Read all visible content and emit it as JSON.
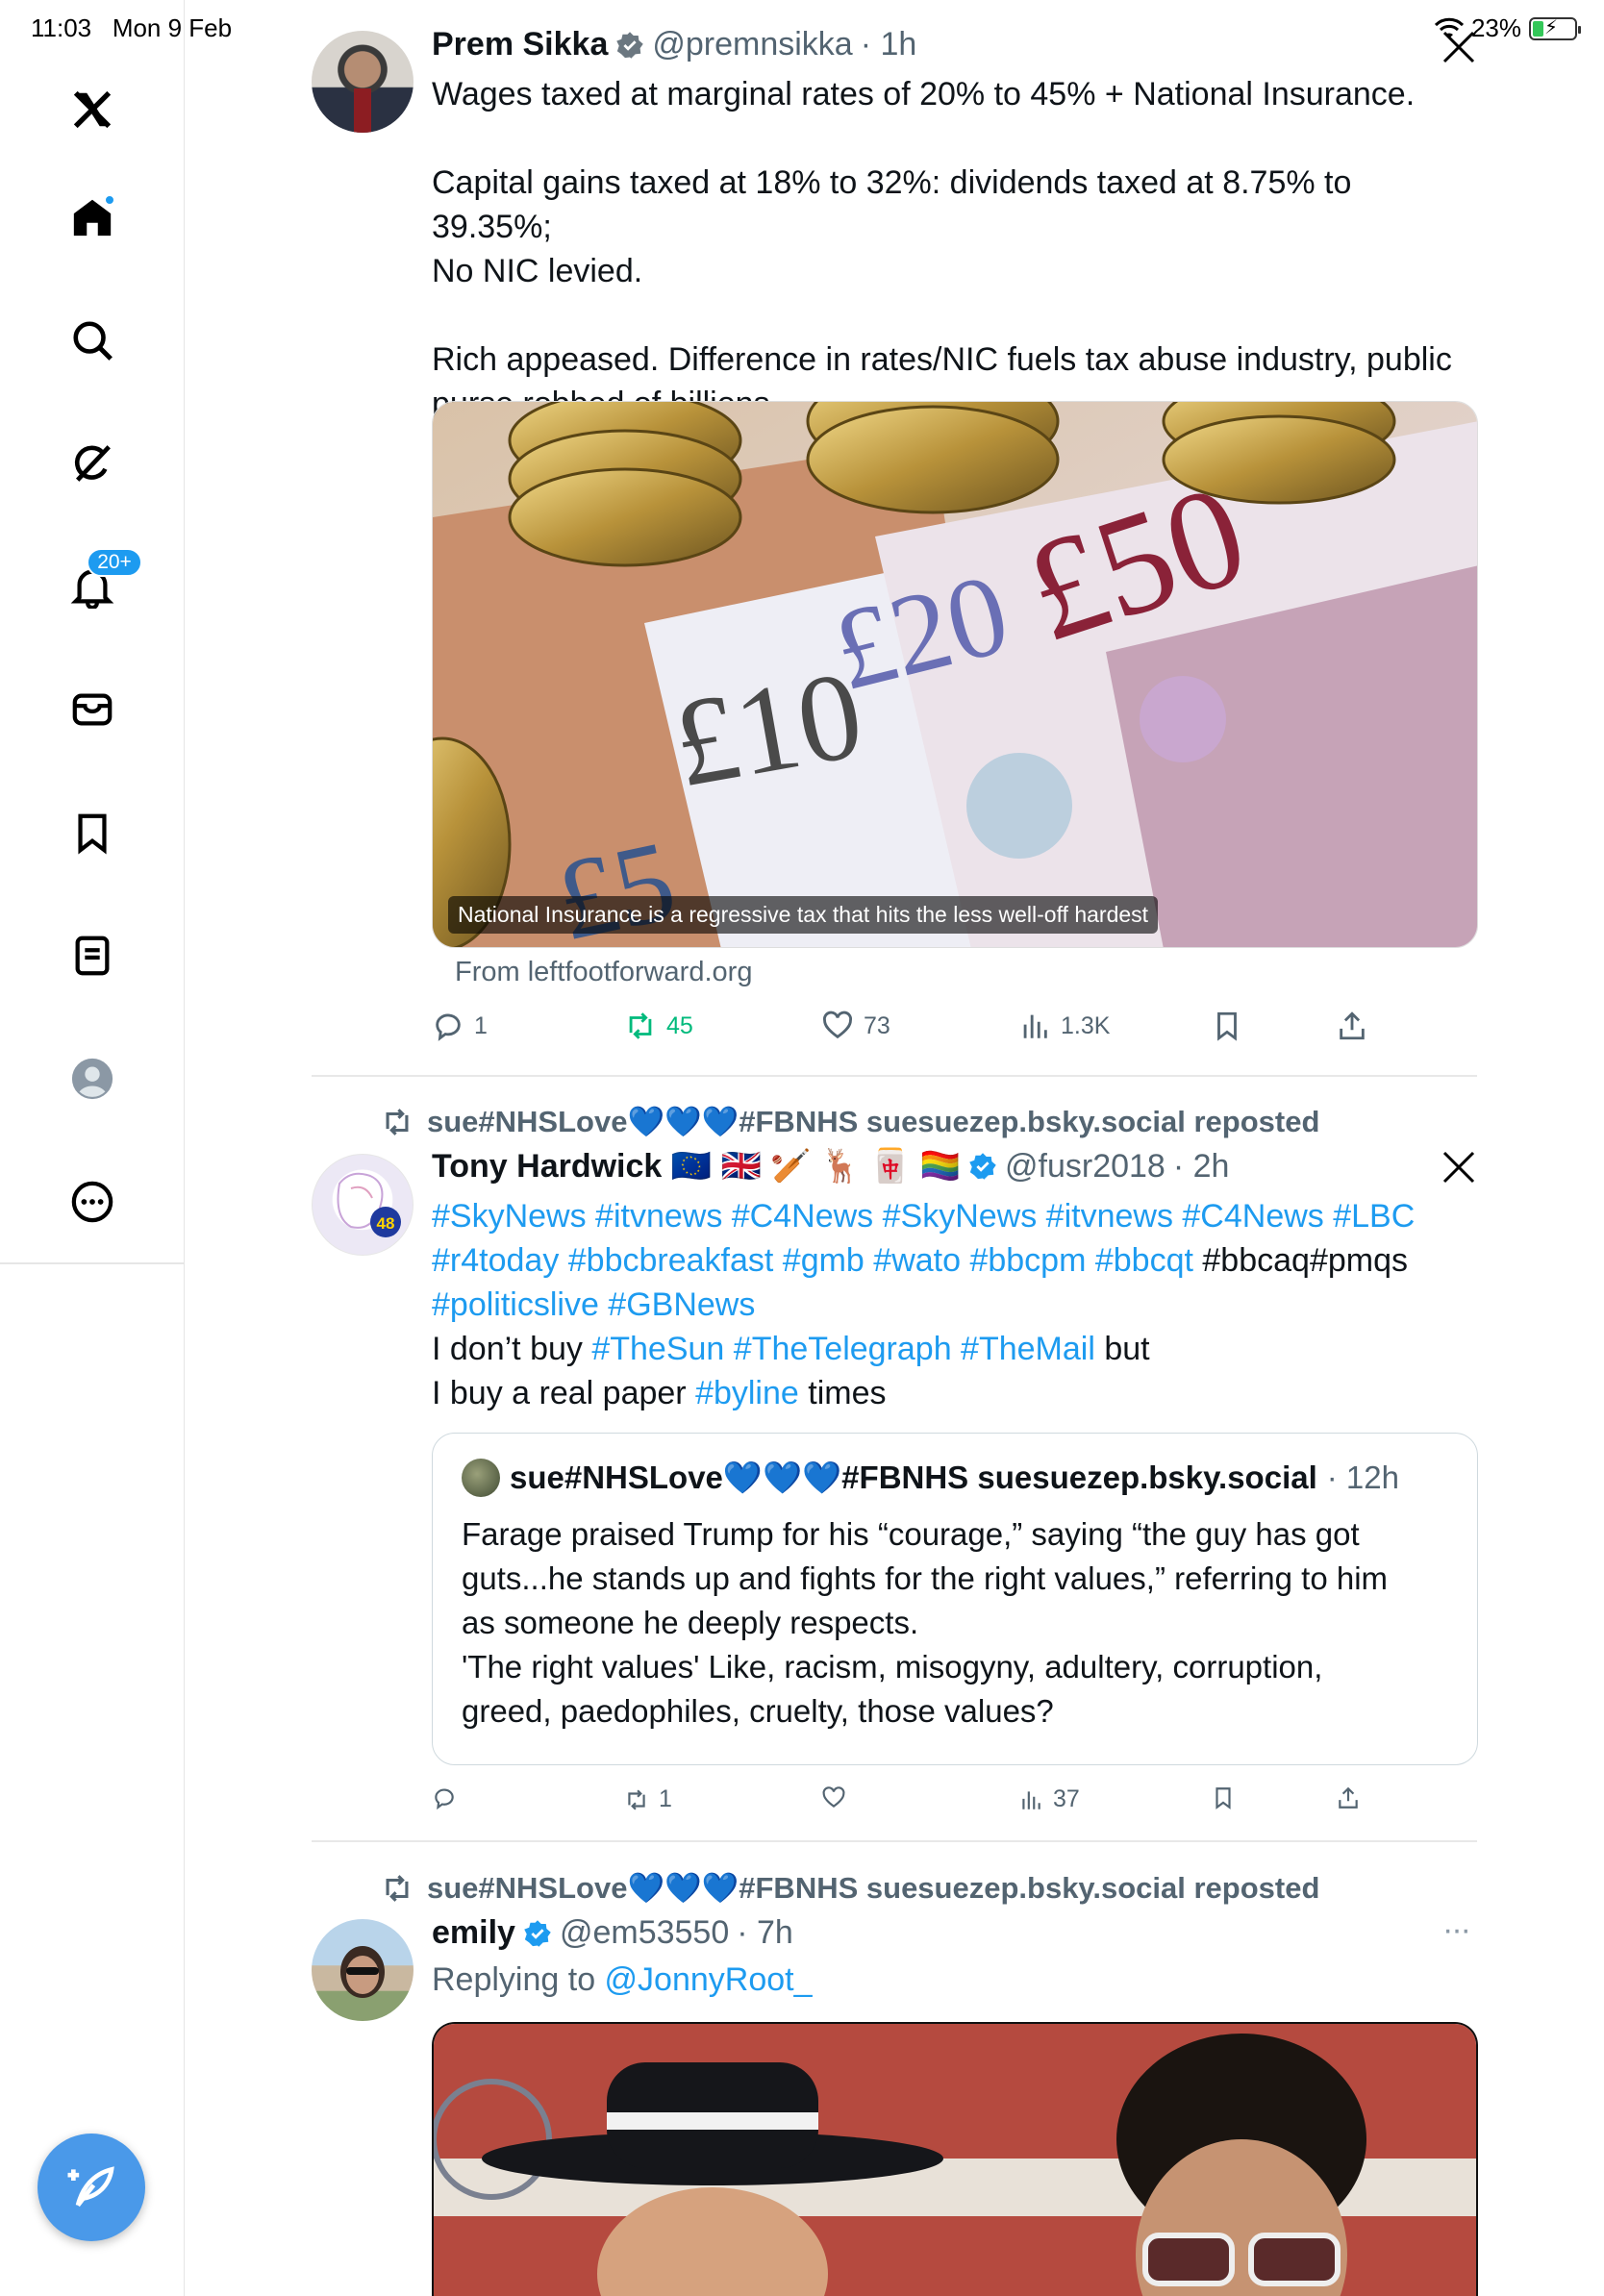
{
  "status_bar": {
    "time": "11:03",
    "date": "Mon 9 Feb",
    "battery": "23%"
  },
  "sidebar": {
    "items": [
      {
        "name": "x-logo",
        "label": "X"
      },
      {
        "name": "home",
        "label": "Home"
      },
      {
        "name": "search",
        "label": "Search"
      },
      {
        "name": "grok",
        "label": "Grok"
      },
      {
        "name": "notifications",
        "label": "Notifications",
        "badge": "20+"
      },
      {
        "name": "messages",
        "label": "Messages"
      },
      {
        "name": "bookmarks",
        "label": "Bookmarks"
      },
      {
        "name": "lists",
        "label": "Lists"
      },
      {
        "name": "profile",
        "label": "Profile"
      },
      {
        "name": "more",
        "label": "More"
      }
    ],
    "compose_icon": "compose-feather-icon"
  },
  "tweets": [
    {
      "name": "Prem Sikka",
      "handle": "@premnsikka",
      "time": "· 1h",
      "text": [
        "Wages taxed at marginal rates of 20% to 45% + National Insurance.",
        "",
        "Capital gains taxed at 18% to 32%: dividends taxed at 8.75% to 39.35%;",
        "No NIC levied.",
        "",
        "Rich appeased. Difference in rates/NIC fuels tax abuse industry, public",
        "purse robbed of billions."
      ],
      "media_caption": "National Insurance is a regressive tax that hits the less well-off hardest",
      "media_source": "From leftfootforward.org",
      "replies": "1",
      "reposts": "45",
      "likes": "73",
      "views": "1.3K"
    },
    {
      "reposted_by": "sue#NHSLove💙💙💙#FBNHS suesuezep.bsky.social reposted",
      "name": "Tony Hardwick 🇪🇺 🇬🇧 🏏 🦌 🀄 🏳️‍🌈",
      "handle": "@fusr2018",
      "time": "· 2h",
      "avatar_badge": "48",
      "text_line1": "#SkyNews #itvnews #C4News #SkyNews #itvnews #C4News #LBC",
      "text_line2_links": "#r4today #bbcbreakfast #gmb #wato #bbcpm #bbcqt",
      "text_line2_plain": " #bbcaq#pmqs",
      "text_line3": "#politicslive #GBNews",
      "text_line4_a": "I don’t buy ",
      "text_line4_links": "#TheSun #TheTelegraph #TheMail",
      "text_line4_b": " but",
      "text_line5_a": "I buy a real paper ",
      "text_line5_link": "#byline",
      "text_line5_b": " times",
      "quote": {
        "name": "sue#NHSLove💙💙💙#FBNHS suesuezep.bsky.social",
        "time": "· 12h",
        "text": [
          "Farage praised Trump for his “courage,” saying “the guy has got",
          "guts...he stands up and fights for the right values,” referring to him",
          "as someone he deeply respects.",
          "'The right values' Like, racism, misogyny, adultery, corruption,",
          "greed, paedophiles, cruelty,  those values?"
        ]
      },
      "reposts": "1",
      "views": "37"
    },
    {
      "reposted_by": "sue#NHSLove💙💙💙#FBNHS suesuezep.bsky.social reposted",
      "name": "emily",
      "handle": "@em53550",
      "time": "· 7h",
      "replying_prefix": "Replying to ",
      "replying_to": "@JonnyRoot_",
      "more": "···"
    }
  ]
}
